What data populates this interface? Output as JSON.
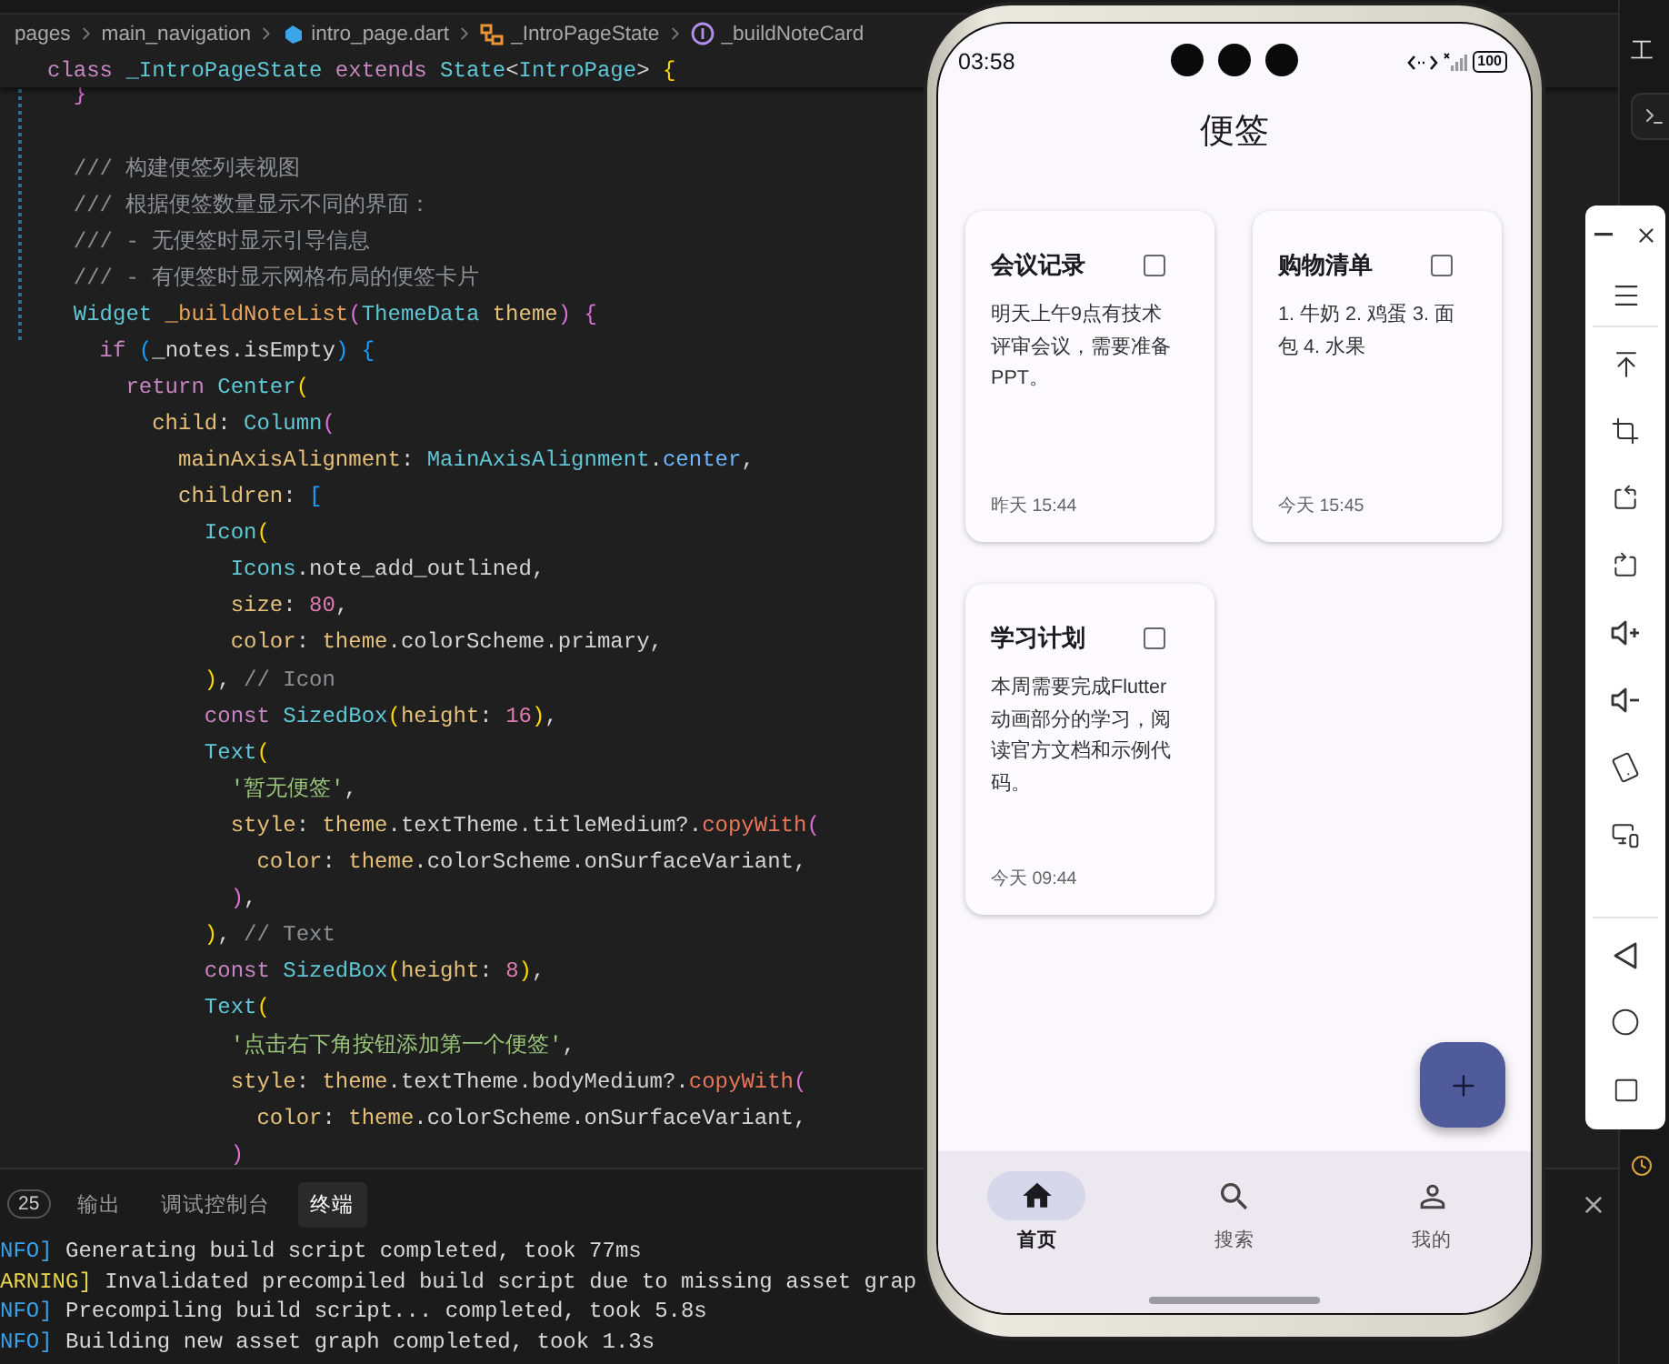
{
  "editor": {
    "breadcrumb": [
      {
        "label": "pages",
        "kind": "folder"
      },
      {
        "label": "main_navigation",
        "kind": "folder"
      },
      {
        "label": "intro_page.dart",
        "kind": "file"
      },
      {
        "label": "_IntroPageState",
        "kind": "class"
      },
      {
        "label": "_buildNoteCard",
        "kind": "method"
      }
    ],
    "sticky_line": {
      "tokens": [
        {
          "text": "class",
          "kind": "kw"
        },
        {
          "text": " _IntroPageState",
          "kind": "type"
        },
        {
          "text": " extends",
          "kind": "kw"
        },
        {
          "text": " State",
          "kind": "type"
        },
        {
          "text": "<",
          "kind": "plain"
        },
        {
          "text": "IntroPage",
          "kind": "type"
        },
        {
          "text": ">",
          "kind": "plain"
        },
        {
          "text": " {",
          "kind": "b1"
        }
      ]
    },
    "sections": [
      {
        "lines": [
          {
            "tokens": [
              {
                "text": "  }",
                "kind": "b2"
              }
            ]
          }
        ]
      },
      {
        "lines": [
          {
            "tokens": [
              {
                "text": "  /// 构建便签列表视图",
                "kind": "cmt"
              }
            ]
          },
          {
            "tokens": [
              {
                "text": "  /// 根据便签数量显示不同的界面：",
                "kind": "cmt"
              }
            ]
          },
          {
            "tokens": [
              {
                "text": "  /// - 无便签时显示引导信息",
                "kind": "cmt"
              }
            ]
          },
          {
            "tokens": [
              {
                "text": "  /// - 有便签时显示网格布局的便签卡片",
                "kind": "cmt"
              }
            ]
          },
          {
            "tokens": [
              {
                "text": "  Widget",
                "kind": "type"
              },
              {
                "text": " _buildNoteList",
                "kind": "fn"
              },
              {
                "text": "(",
                "kind": "b2"
              },
              {
                "text": "ThemeData",
                "kind": "type"
              },
              {
                "text": " theme",
                "kind": "prop"
              },
              {
                "text": ")",
                "kind": "b2"
              },
              {
                "text": " {",
                "kind": "b2"
              }
            ]
          },
          {
            "tokens": [
              {
                "text": "    if",
                "kind": "kw"
              },
              {
                "text": " (",
                "kind": "b3"
              },
              {
                "text": "_notes.isEmpty",
                "kind": "plain"
              },
              {
                "text": ")",
                "kind": "b3"
              },
              {
                "text": " {",
                "kind": "b3"
              }
            ]
          },
          {
            "tokens": [
              {
                "text": "      return",
                "kind": "kw"
              },
              {
                "text": " Center",
                "kind": "type"
              },
              {
                "text": "(",
                "kind": "b1"
              }
            ]
          },
          {
            "tokens": [
              {
                "text": "        child",
                "kind": "prop"
              },
              {
                "text": ": ",
                "kind": "plain"
              },
              {
                "text": "Column",
                "kind": "type"
              },
              {
                "text": "(",
                "kind": "b2"
              }
            ]
          },
          {
            "tokens": [
              {
                "text": "          mainAxisAlignment",
                "kind": "prop"
              },
              {
                "text": ": ",
                "kind": "plain"
              },
              {
                "text": "MainAxisAlignment",
                "kind": "type"
              },
              {
                "text": ".",
                "kind": "plain"
              },
              {
                "text": "center",
                "kind": "enum"
              },
              {
                "text": ",",
                "kind": "plain"
              }
            ]
          },
          {
            "tokens": [
              {
                "text": "          children",
                "kind": "prop"
              },
              {
                "text": ": ",
                "kind": "plain"
              },
              {
                "text": "[",
                "kind": "b3"
              }
            ]
          },
          {
            "tokens": [
              {
                "text": "            Icon",
                "kind": "type"
              },
              {
                "text": "(",
                "kind": "b1"
              }
            ]
          },
          {
            "tokens": [
              {
                "text": "              Icons",
                "kind": "type"
              },
              {
                "text": ".note_add_outlined,",
                "kind": "plain"
              }
            ]
          },
          {
            "tokens": [
              {
                "text": "              size",
                "kind": "prop"
              },
              {
                "text": ": ",
                "kind": "plain"
              },
              {
                "text": "80",
                "kind": "num"
              },
              {
                "text": ",",
                "kind": "plain"
              }
            ]
          },
          {
            "tokens": [
              {
                "text": "              color",
                "kind": "prop"
              },
              {
                "text": ": ",
                "kind": "plain"
              },
              {
                "text": "theme",
                "kind": "prop"
              },
              {
                "text": ".colorScheme.primary,",
                "kind": "plain"
              }
            ]
          },
          {
            "tokens": [
              {
                "text": "            )",
                "kind": "b1"
              },
              {
                "text": ", ",
                "kind": "plain"
              },
              {
                "text": "// Icon",
                "kind": "cmt"
              }
            ]
          },
          {
            "tokens": [
              {
                "text": "            const",
                "kind": "kw"
              },
              {
                "text": " SizedBox",
                "kind": "type"
              },
              {
                "text": "(",
                "kind": "b1"
              },
              {
                "text": "height",
                "kind": "prop"
              },
              {
                "text": ": ",
                "kind": "plain"
              },
              {
                "text": "16",
                "kind": "num"
              },
              {
                "text": ")",
                "kind": "b1"
              },
              {
                "text": ",",
                "kind": "plain"
              }
            ]
          },
          {
            "tokens": [
              {
                "text": "            Text",
                "kind": "type"
              },
              {
                "text": "(",
                "kind": "b1"
              }
            ]
          },
          {
            "tokens": [
              {
                "text": "              '暂无便签'",
                "kind": "str"
              },
              {
                "text": ",",
                "kind": "plain"
              }
            ]
          },
          {
            "tokens": [
              {
                "text": "              style",
                "kind": "prop"
              },
              {
                "text": ": ",
                "kind": "plain"
              },
              {
                "text": "theme",
                "kind": "prop"
              },
              {
                "text": ".textTheme.titleMedium?.",
                "kind": "plain"
              },
              {
                "text": "copyWith",
                "kind": "method"
              },
              {
                "text": "(",
                "kind": "b2"
              }
            ]
          },
          {
            "tokens": [
              {
                "text": "                color",
                "kind": "prop"
              },
              {
                "text": ": ",
                "kind": "plain"
              },
              {
                "text": "theme",
                "kind": "prop"
              },
              {
                "text": ".colorScheme.onSurfaceVariant,",
                "kind": "plain"
              }
            ]
          },
          {
            "tokens": [
              {
                "text": "              )",
                "kind": "b2"
              },
              {
                "text": ",",
                "kind": "plain"
              }
            ]
          },
          {
            "tokens": [
              {
                "text": "            )",
                "kind": "b1"
              },
              {
                "text": ", ",
                "kind": "plain"
              },
              {
                "text": "// Text",
                "kind": "cmt"
              }
            ]
          },
          {
            "tokens": [
              {
                "text": "            const",
                "kind": "kw"
              },
              {
                "text": " SizedBox",
                "kind": "type"
              },
              {
                "text": "(",
                "kind": "b1"
              },
              {
                "text": "height",
                "kind": "prop"
              },
              {
                "text": ": ",
                "kind": "plain"
              },
              {
                "text": "8",
                "kind": "num"
              },
              {
                "text": ")",
                "kind": "b1"
              },
              {
                "text": ",",
                "kind": "plain"
              }
            ]
          },
          {
            "tokens": [
              {
                "text": "            Text",
                "kind": "type"
              },
              {
                "text": "(",
                "kind": "b1"
              }
            ]
          },
          {
            "tokens": [
              {
                "text": "              '点击右下角按钮添加第一个便签'",
                "kind": "str"
              },
              {
                "text": ",",
                "kind": "plain"
              }
            ]
          },
          {
            "tokens": [
              {
                "text": "              style",
                "kind": "prop"
              },
              {
                "text": ": ",
                "kind": "plain"
              },
              {
                "text": "theme",
                "kind": "prop"
              },
              {
                "text": ".textTheme.bodyMedium?.",
                "kind": "plain"
              },
              {
                "text": "copyWith",
                "kind": "method"
              },
              {
                "text": "(",
                "kind": "b2"
              }
            ]
          },
          {
            "tokens": [
              {
                "text": "                color",
                "kind": "prop"
              },
              {
                "text": ": ",
                "kind": "plain"
              },
              {
                "text": "theme",
                "kind": "prop"
              },
              {
                "text": ".colorScheme.onSurfaceVariant,",
                "kind": "plain"
              }
            ]
          },
          {
            "tokens": [
              {
                "text": "              )",
                "kind": "b2"
              }
            ]
          }
        ]
      }
    ]
  },
  "panel": {
    "problems_count": "25",
    "tabs": [
      {
        "label": "输出",
        "selected": false
      },
      {
        "label": "调试控制台",
        "selected": false
      },
      {
        "label": "终端",
        "selected": true
      }
    ],
    "terminal": [
      {
        "level": "NFO]",
        "kind": "info",
        "message": " Generating build script completed, took 77ms"
      },
      {
        "level": "ARNING]",
        "kind": "warning",
        "message": " Invalidated precompiled build script due to missing asset grap"
      },
      {
        "level": "NFO]",
        "kind": "info",
        "message": " Precompiling build script... completed, took 5.8s"
      },
      {
        "level": "NFO]",
        "kind": "info",
        "message": " Building new asset graph completed, took 1.3s"
      }
    ]
  },
  "right_panel": {
    "heading": "工"
  },
  "phone": {
    "status": {
      "time": "03:58",
      "battery": "100"
    },
    "title": "便签",
    "notes": [
      {
        "title": "会议记录",
        "checked": false,
        "content": "明天上午9点有技术评审会议，需要准备PPT。",
        "time": "昨天 15:44"
      },
      {
        "title": "购物清单",
        "checked": false,
        "content": "1. 牛奶 2. 鸡蛋 3. 面包 4. 水果",
        "time": "今天 15:45"
      },
      {
        "title": "学习计划",
        "checked": false,
        "content": "本周需要完成Flutter动画部分的学习，阅读官方文档和示例代码。",
        "time": "今天 09:44"
      }
    ],
    "nav": [
      {
        "label": "首页",
        "kind": "home",
        "selected": true
      },
      {
        "label": "搜索",
        "kind": "search",
        "selected": false
      },
      {
        "label": "我的",
        "kind": "profile",
        "selected": false
      }
    ]
  }
}
